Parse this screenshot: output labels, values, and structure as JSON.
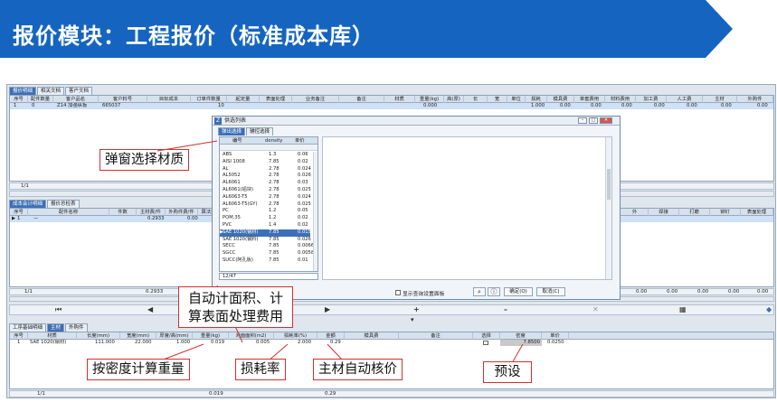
{
  "banner": {
    "title": "报价模块：工程报价（标准成本库）",
    "color": "#1565c0"
  },
  "top_tabs": [
    "报价明细",
    "相关文档",
    "客户文档"
  ],
  "top_table": {
    "headers": [
      "序号",
      "配件数量",
      "客户品名",
      "客户料号",
      "目标成本",
      "订单件数量",
      "起定量",
      "表面处理",
      "业务备注",
      "备注",
      "材质",
      "重量(kg)",
      "高(厚)",
      "长",
      "宽",
      "单位",
      "损耗",
      "模具费",
      "单套费用",
      "材料费用",
      "加工费",
      "人工费",
      "主材",
      "外购件"
    ],
    "row": [
      "1",
      "0",
      "Z14 加强纵板",
      "665037",
      "",
      "10",
      "",
      "",
      "",
      "",
      "",
      "0.000",
      "",
      "",
      "",
      "",
      "1.000",
      "0.00",
      "0.00",
      "0.00",
      "0.00",
      "0.00",
      "0.00",
      "0.00"
    ]
  },
  "top_footer": "1/1",
  "mid_tabs": [
    "成本会计明细",
    "报价总检表"
  ],
  "mid_table": {
    "headers": [
      "序号",
      "配件名称",
      "件数",
      "主材费/件",
      "外购件费/件",
      "算法费"
    ],
    "row": [
      "1",
      "—",
      "",
      "0.2933",
      "0.00",
      ""
    ],
    "right_headers": [
      "外",
      "焊接",
      "打磨",
      "铆钉",
      "表面处理"
    ],
    "right_values": [
      "0.00",
      "0.00",
      "0.00",
      "0.00",
      "0.00"
    ]
  },
  "mid_footer": {
    "page": "1/1",
    "total": "0.2933",
    "right_values": [
      "0.00",
      "0.00",
      "0.00",
      "0.00",
      "0.00"
    ]
  },
  "bottom_tabs": [
    "工序基础明细",
    "主材",
    "外购件"
  ],
  "bottom_table": {
    "headers": [
      "序号",
      "材质",
      "长度(mm)",
      "宽度(mm)",
      "厚度/高(mm)",
      "重量(kg)",
      "对面面积(m2)",
      "损耗率(%)",
      "金额",
      "模具费",
      "备注",
      "选择",
      "密度",
      "单价"
    ],
    "row": [
      "1",
      "SAE 1020(钢材)",
      "111.000",
      "22.000",
      "1.000",
      "0.019",
      "0.005",
      "2.000",
      "0.29",
      "",
      "",
      "",
      "7.8500",
      "0.0250"
    ]
  },
  "bottom_footer": {
    "page": "1/1",
    "weight": "0.019",
    "amount": "0.29"
  },
  "dialog": {
    "title": "供选列表",
    "tabs": [
      "弹出选择",
      "辅控选择"
    ],
    "columns": [
      "编号",
      "density",
      "单价"
    ],
    "rows": [
      [
        "ABS",
        "1.3",
        "0.06"
      ],
      [
        "AISI 1008",
        "7.85",
        "0.02"
      ],
      [
        "AL",
        "2.78",
        "0.024"
      ],
      [
        "AL5052",
        "2.78",
        "0.026"
      ],
      [
        "AL6061",
        "2.78",
        "0.03"
      ],
      [
        "AL6061(铝块)",
        "2.78",
        "0.025"
      ],
      [
        "AL6063-T5",
        "2.78",
        "0.024"
      ],
      [
        "AL6063-T5(GY)",
        "2.78",
        "0.025"
      ],
      [
        "PC",
        "1.2",
        "0.05"
      ],
      [
        "POM.35",
        "1.2",
        "0.02"
      ],
      [
        "PVC",
        "1.4",
        "0.02"
      ],
      [
        "SAE 1020(钢材)",
        "7.85",
        "0.015"
      ],
      [
        "SAE 1020(钢料)",
        "7.85",
        "0.026"
      ],
      [
        "SECC",
        "7.85",
        "0.0066"
      ],
      [
        "SGCC",
        "7.85",
        "0.0058"
      ],
      [
        "SUCC(阿孔板)",
        "7.85",
        "0.01"
      ]
    ],
    "count": "12/47",
    "checkbox_label": "显示查询设置面板",
    "ok": "确定(O)",
    "cancel": "取消(C)"
  },
  "callouts": {
    "select_material": "弹窗选择材质",
    "auto_area": "自动计面积、计算表面处理费用",
    "density_weight": "按密度计算重量",
    "loss_rate": "损耗率",
    "auto_price": "主材自动核价",
    "preset": "预设"
  },
  "icons": [
    "prev-icon",
    "next-icon",
    "add-icon",
    "remove-icon",
    "settings-icon",
    "search-icon",
    "info-icon",
    "tag-icon"
  ]
}
